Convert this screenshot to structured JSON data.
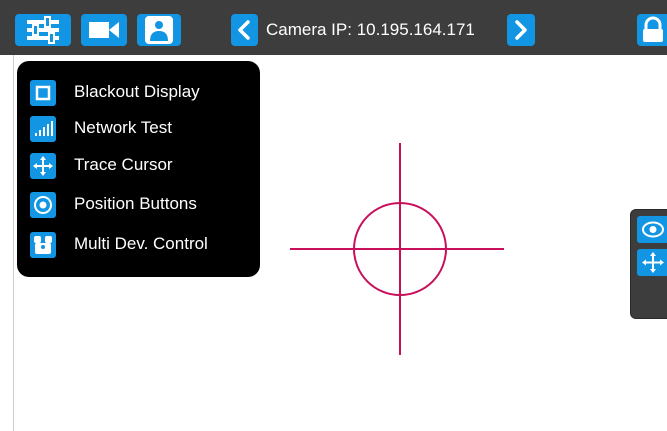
{
  "topbar": {
    "camera_ip_label": "Camera IP: 10.195.164.171",
    "icons": [
      "settings-sliders-icon",
      "video-camera-icon",
      "user-icon",
      "chevron-left-icon",
      "chevron-right-icon",
      "lock-icon"
    ]
  },
  "menu": {
    "items": [
      {
        "label": "Blackout Display",
        "icon": "square-icon"
      },
      {
        "label": "Network Test",
        "icon": "signal-bars-icon"
      },
      {
        "label": "Trace Cursor",
        "icon": "move-arrows-icon"
      },
      {
        "label": "Position Buttons",
        "icon": "target-circle-icon"
      },
      {
        "label": "Multi Dev. Control",
        "icon": "multi-device-icon"
      }
    ]
  },
  "side_panel": {
    "icons": [
      "eye-icon",
      "move-arrows-icon"
    ]
  },
  "colors": {
    "topbar_bg": "#3d3d3d",
    "accent_blue": "#1296e4",
    "menu_bg": "#000000",
    "crosshair": "#c8105a"
  }
}
